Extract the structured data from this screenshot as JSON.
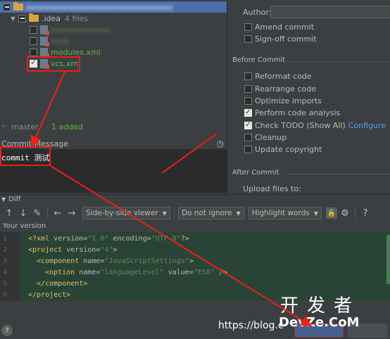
{
  "tree": {
    "root_label": "",
    "idea_folder": ".idea",
    "idea_count": "4 files",
    "files": [
      {
        "name": "",
        "checked": false
      },
      {
        "name": "",
        "checked": false
      },
      {
        "name": "modules.xml",
        "checked": false
      },
      {
        "name": "vcs.xml",
        "checked": true
      }
    ]
  },
  "status": {
    "branch": "master",
    "added": "1 added"
  },
  "commit_message": {
    "label": "Commit Message",
    "text": "commit 测试"
  },
  "right_panel": {
    "author_label": "Author:",
    "author_value": "",
    "amend_commit": "Amend commit",
    "sign_off_commit": "Sign-off commit",
    "before_commit_title": "Before Commit",
    "options": [
      {
        "label": "Reformat code",
        "checked": false
      },
      {
        "label": "Rearrange code",
        "checked": false
      },
      {
        "label": "Optimize imports",
        "checked": false
      },
      {
        "label": "Perform code analysis",
        "checked": true
      },
      {
        "label": "Check TODO (Show All)",
        "checked": true,
        "link": "Configure"
      },
      {
        "label": "Cleanup",
        "checked": false
      },
      {
        "label": "Update copyright",
        "checked": false
      }
    ],
    "after_commit_title": "After Commit",
    "upload_files_to": "Upload files to:"
  },
  "diff": {
    "title": "Diff",
    "viewer_mode": "Side-by-side viewer",
    "ignore_mode": "Do not ignore",
    "highlight_mode": "Highlight words",
    "your_version_label": "Your version",
    "lines": [
      {
        "n": "1",
        "parts": [
          [
            "tag",
            "<?xml "
          ],
          [
            "attr",
            "version="
          ],
          [
            "val",
            "\"1.0\""
          ],
          [
            "attr",
            " encoding="
          ],
          [
            "val",
            "\"UTF-8\""
          ],
          [
            "tag",
            "?>"
          ]
        ]
      },
      {
        "n": "2",
        "parts": [
          [
            "tag",
            "<project "
          ],
          [
            "attr",
            "version="
          ],
          [
            "val",
            "\"4\""
          ],
          [
            "tag",
            ">"
          ]
        ]
      },
      {
        "n": "3",
        "parts": [
          [
            "tag",
            "  <component "
          ],
          [
            "attr",
            "name="
          ],
          [
            "val",
            "\"JavaScriptSettings\""
          ],
          [
            "tag",
            ">"
          ]
        ]
      },
      {
        "n": "4",
        "parts": [
          [
            "tag",
            "    <option "
          ],
          [
            "attr",
            "name="
          ],
          [
            "val",
            "\"languageLevel\""
          ],
          [
            "attr",
            " value="
          ],
          [
            "val",
            "\"ES6\""
          ],
          [
            "tag",
            " />"
          ]
        ]
      },
      {
        "n": "5",
        "parts": [
          [
            "tag",
            "  </component>"
          ]
        ]
      },
      {
        "n": "6",
        "parts": [
          [
            "tag",
            "</project>"
          ]
        ]
      }
    ]
  },
  "bottom": {
    "help": "?",
    "commit_label": "Commit",
    "cancel_label": "Cancel"
  },
  "watermark": {
    "url": "https://blog.c",
    "cn": "开发者",
    "brand": "DevZe.CoM"
  },
  "colors": {
    "accent_red": "#e8211a",
    "selection": "#4b6eaf",
    "diff_insert_bg": "#294436",
    "link": "#589df6"
  }
}
